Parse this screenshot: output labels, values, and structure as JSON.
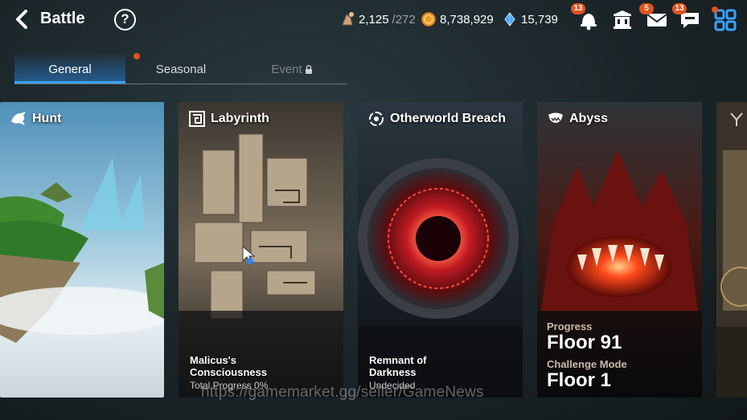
{
  "header": {
    "title": "Battle",
    "help_label": "?",
    "stamina": "2,125",
    "stamina_max": "/272",
    "gold": "8,738,929",
    "crystals": "15,739",
    "notifications_count": "13",
    "mail_count": "5",
    "chat_count": "13"
  },
  "tabs": [
    {
      "label": "General",
      "active": true
    },
    {
      "label": "Seasonal",
      "active": false
    },
    {
      "label": "Event",
      "active": false,
      "locked": true
    }
  ],
  "cards": {
    "hunt": {
      "title": "Hunt"
    },
    "labyrinth": {
      "title": "Labyrinth",
      "subtitle": "Malicus's Consciousness",
      "status": "Total Progress 0%"
    },
    "otherworld": {
      "title": "Otherworld Breach",
      "subtitle": "Remnant of Darkness",
      "status": "Undecided"
    },
    "abyss": {
      "title": "Abyss",
      "progress_label": "Progress",
      "progress_value": "Floor 91",
      "challenge_label": "Challenge Mode",
      "challenge_value": "Floor 1"
    }
  },
  "watermark": "https://gamemarket.gg/seller/GameNews",
  "colors": {
    "accent": "#3ba1ff",
    "badge": "#e0531f"
  }
}
